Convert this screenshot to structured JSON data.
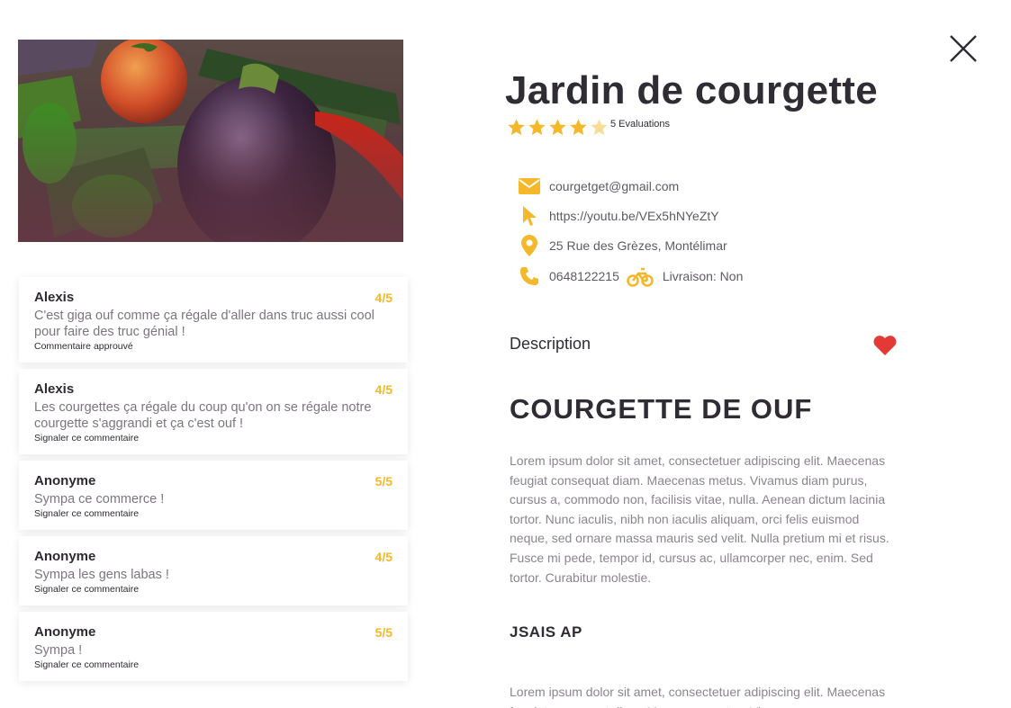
{
  "close": {
    "icon": "close-icon"
  },
  "hero": {
    "image": "vegetables-photo"
  },
  "colors": {
    "accent": "#f4b82a",
    "heart": "#e53935",
    "text_dark": "#2f2c33",
    "text_muted": "#8a858c"
  },
  "product": {
    "title": "Jardin de courgette",
    "rating_stars": 4,
    "rating_max": 5,
    "evaluations": "5 Evaluations"
  },
  "contact": {
    "email": "courgetget@gmail.com",
    "website": "https://youtu.be/VEx5hNYeZtY",
    "address": "25 Rue des Grèzes, Montélimar",
    "phone": "0648122215",
    "delivery": "Livraison: Non"
  },
  "description": {
    "label": "Description",
    "heading1": "COURGETTE DE OUF",
    "paragraph1": "Lorem ipsum dolor sit amet, consectetuer adipiscing elit. Maecenas feugiat consequat diam. Maecenas metus. Vivamus diam purus, cursus a, commodo non, facilisis vitae, nulla. Aenean dictum lacinia tortor. Nunc iaculis, nibh non iaculis aliquam, orci felis euismod neque, sed ornare massa mauris sed velit. Nulla pretium mi et risus. Fusce mi pede, tempor id, cursus ac, ullamcorper nec, enim. Sed tortor. Curabitur molestie.",
    "heading2": "JSAIS AP",
    "paragraph2": "Lorem ipsum dolor sit amet, consectetuer adipiscing elit. Maecenas feugiat consequat diam. Maecenas metus. Vivamus"
  },
  "comments": [
    {
      "author": "Alexis",
      "rating": "4/5",
      "text": "C'est giga ouf comme ça régale d'aller dans truc aussi cool pour faire des truc génial !",
      "action": "Commentaire approuvé"
    },
    {
      "author": "Alexis",
      "rating": "4/5",
      "text": "Les courgettes ça régale du coup qu'on on se régale notre courgette s'aggrandi et ça c'est ouf !",
      "action": "Signaler ce commentaire"
    },
    {
      "author": "Anonyme",
      "rating": "5/5",
      "text": "Sympa ce commerce !",
      "action": "Signaler ce commentaire"
    },
    {
      "author": "Anonyme",
      "rating": "4/5",
      "text": "Sympa les gens labas !",
      "action": "Signaler ce commentaire"
    },
    {
      "author": "Anonyme",
      "rating": "5/5",
      "text": "Sympa !",
      "action": "Signaler ce commentaire"
    }
  ]
}
